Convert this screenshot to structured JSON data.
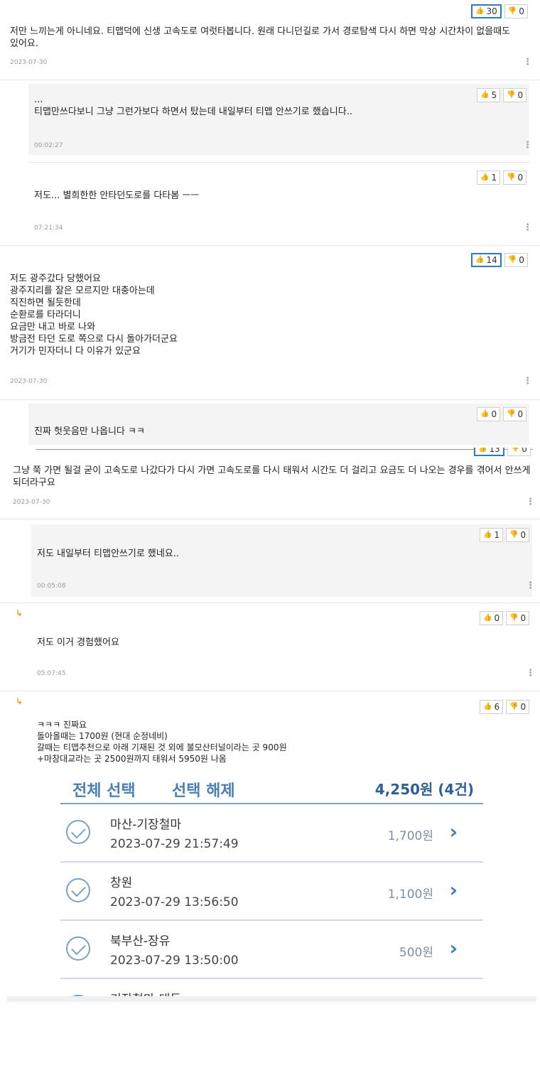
{
  "comments": [
    {
      "text": "저만 느끼는게 아니네요. 티맵덕에 신생 고속도로 여럿타봅니다. 원래 다니던길로 가서 경로탐색 다시 하면 막상 시간차이 없을때도 있어요.",
      "date": "2023-07-30",
      "up": "30",
      "down": "0"
    },
    {
      "text": "...\n티맵만쓰다보니 그냥 그런가보다 하면서 탔는데 내일부터 티맵 안쓰기로 했습니다..",
      "date": "00:02:27",
      "up": "5",
      "down": "0"
    },
    {
      "text": "저도... 별희한한 안타던도로를 다타봄 ㅡㅡ",
      "date": "07:21:34",
      "up": "1",
      "down": "0"
    },
    {
      "text": "저도 광주갔다 당했어요\n광주지리를 잘은 모르지만 대충아는데\n직진하면 될듯한데\n순환로를 타라더니\n요금만 내고 바로 나와\n방금전 타던 도로 쪽으로 다시 돌아가더군요\n거기가 민자더니 다 이유가 있군요",
      "date": "2023-07-30",
      "up": "14",
      "down": "0"
    },
    {
      "text": "진짜 헛웃음만 나옵니다 ㅋㅋ",
      "date": "",
      "up": "0",
      "down": "0"
    },
    {
      "text": "그냥 쭉 가면 될걸 굳이 고속도로 나갔다가 다시 가면 고속도로를 다시 태워서 시간도 더 걸리고 요금도 더 나오는 경우를 겪어서 안쓰게 되더라구요",
      "date": "2023-07-30",
      "up": "13",
      "down": "0"
    },
    {
      "text": "저도 내일부터 티맵안쓰기로 했네요..",
      "date": "00:05:08",
      "up": "1",
      "down": "0"
    },
    {
      "text": "저도 이거 경험했어요",
      "date": "05:07:45",
      "up": "0",
      "down": "0"
    },
    {
      "text": "ㅋㅋㅋ 진짜요\n돌아올때는 1700원 (현대 순정네비)\n갈때는 티맵추천으로 아래 기재된 것 외에 불모산터널이라는 곳 900원\n+마창대교라는 곳 2500원까지 태워서 5950원 나옴",
      "date": "",
      "up": "6",
      "down": "0"
    }
  ],
  "toll": {
    "select_all": "전체 선택",
    "deselect": "선택 해제",
    "total": "4,250원 (4건)",
    "rows": [
      {
        "name": "마산-기장철마",
        "time": "2023-07-29 21:57:49",
        "amount": "1,700원"
      },
      {
        "name": "창원",
        "time": "2023-07-29 13:56:50",
        "amount": "1,100원"
      },
      {
        "name": "북부산-장유",
        "time": "2023-07-29 13:50:00",
        "amount": "500원"
      },
      {
        "name": "기장철마-대동",
        "time": "",
        "amount": ""
      }
    ]
  },
  "colors": {
    "highlight_border": "#2f7bbf",
    "reply_arrow": "#e2a21c",
    "toll_blue": "#3d7cc4"
  },
  "icons": {
    "up": "thumbs-up-icon",
    "down": "thumbs-down-icon",
    "more": "more-vertical-icon",
    "reply": "reply-arrow-icon",
    "check": "check-circle-icon",
    "chevron": "chevron-right-icon"
  }
}
